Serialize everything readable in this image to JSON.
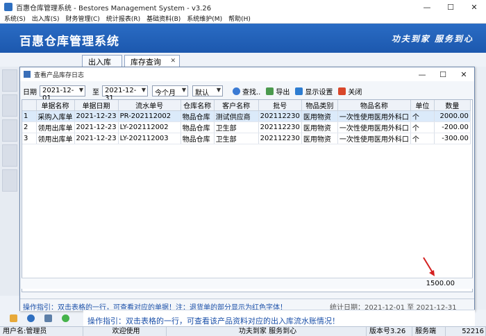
{
  "window": {
    "title": "百惠仓库管理系统 - Bestores Management System - v3.26",
    "min": "—",
    "max": "☐",
    "close": "✕"
  },
  "menu": [
    "系统(S)",
    "出入库(S)",
    "财务管理(C)",
    "统计报表(R)",
    "基础资料(B)",
    "系统维护(M)",
    "帮助(H)"
  ],
  "banner": {
    "brand": "百惠仓库管理系统",
    "slogan": "功夫到家 服务到心"
  },
  "tabs": [
    {
      "label": "出入库"
    },
    {
      "label": "库存查询",
      "close": "✕"
    }
  ],
  "dialog": {
    "title": "查看产品库存日志",
    "min": "—",
    "max": "☐",
    "close": "✕",
    "toolbar": {
      "date_label": "日期",
      "start_date": "2021-12-01",
      "to_label": "至",
      "end_date": "2021-12-31",
      "period": "今个月",
      "sort": "默认",
      "find": "查找..",
      "export": "导出",
      "columns": "显示设置",
      "close": "关闭"
    },
    "grid": {
      "columns": [
        "",
        "单据名称",
        "单据日期",
        "流水单号",
        "仓库名称",
        "客户名称",
        "批号",
        "物品类别",
        "物品名称",
        "单位",
        "数量"
      ],
      "rows": [
        [
          "1",
          "采购入库单",
          "2021-12-23",
          "PR-202112002",
          "物品仓库",
          "测试供应商",
          "202112230",
          "医用物资",
          "一次性使用医用外科口",
          "个",
          "2000.00"
        ],
        [
          "2",
          "领用出库单",
          "2021-12-23",
          "LY-202112002",
          "物品仓库",
          "卫生部",
          "202112230",
          "医用物资",
          "一次性使用医用外科口",
          "个",
          "-200.00"
        ],
        [
          "3",
          "领用出库单",
          "2021-12-23",
          "LY-202112003",
          "物品仓库",
          "卫生部",
          "202112230",
          "医用物资",
          "一次性使用医用外科口",
          "个",
          "-300.00"
        ]
      ],
      "total": "1500.00"
    },
    "status": {
      "hint": "操作指引：双击表格的一行，可查看对应的单据！注：退货单的部分显示为红色字体！",
      "stat": "统计日期：2021-12-01 至 2021-12-31"
    }
  },
  "outer_hint": "操作指引：双击表格的一行，可查看该产品资料对应的出入库流水账情况！",
  "statusbar": {
    "user": "用户名:管理员",
    "welcome": "欢迎使用",
    "slogan": "功夫到家 服务到心",
    "version": "版本号3.26",
    "server": "服务端",
    "port": "52216"
  },
  "colors": {
    "banner": "#1c58ae",
    "hint_text": "#1a4fa8",
    "selected_row": "#dbeafa",
    "arrow": "#d42020"
  }
}
